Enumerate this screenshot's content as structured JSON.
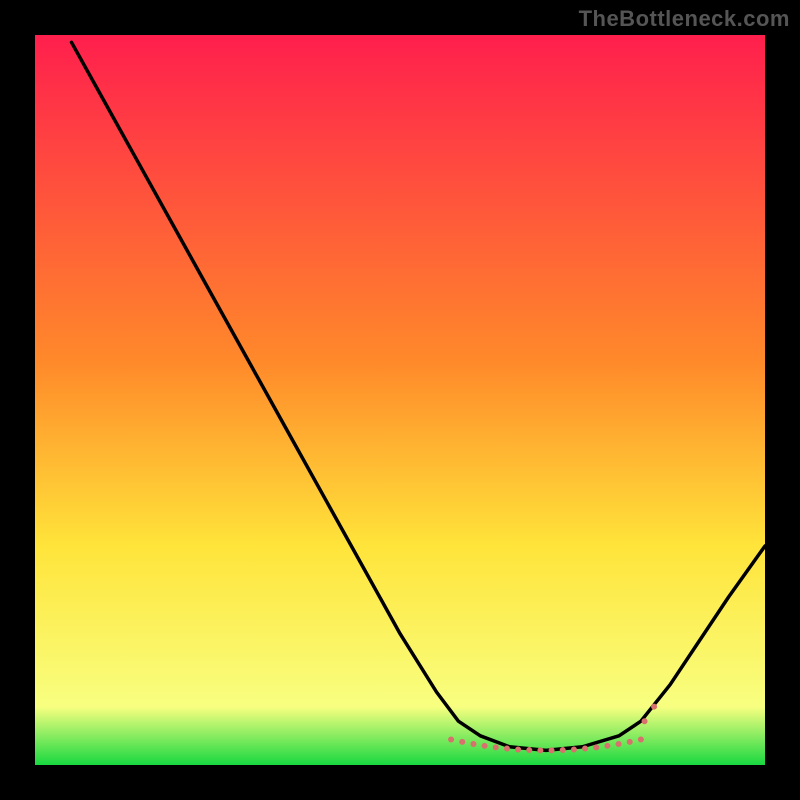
{
  "watermark": "TheBottleneck.com",
  "chart_data": {
    "type": "line",
    "title": "",
    "xlabel": "",
    "ylabel": "",
    "xlim": [
      0,
      100
    ],
    "ylim": [
      0,
      100
    ],
    "gradient_stops": [
      {
        "offset": 0,
        "color": "#ff1f4d"
      },
      {
        "offset": 45,
        "color": "#ff8a2a"
      },
      {
        "offset": 70,
        "color": "#ffe43a"
      },
      {
        "offset": 92,
        "color": "#f8ff80"
      },
      {
        "offset": 100,
        "color": "#18d840"
      }
    ],
    "curve_points": [
      {
        "x": 5,
        "y": 99
      },
      {
        "x": 10,
        "y": 90
      },
      {
        "x": 15,
        "y": 81
      },
      {
        "x": 20,
        "y": 72
      },
      {
        "x": 25,
        "y": 63
      },
      {
        "x": 30,
        "y": 54
      },
      {
        "x": 35,
        "y": 45
      },
      {
        "x": 40,
        "y": 36
      },
      {
        "x": 45,
        "y": 27
      },
      {
        "x": 50,
        "y": 18
      },
      {
        "x": 55,
        "y": 10
      },
      {
        "x": 58,
        "y": 6
      },
      {
        "x": 61,
        "y": 4
      },
      {
        "x": 65,
        "y": 2.5
      },
      {
        "x": 70,
        "y": 2
      },
      {
        "x": 75,
        "y": 2.5
      },
      {
        "x": 80,
        "y": 4
      },
      {
        "x": 83,
        "y": 6
      },
      {
        "x": 87,
        "y": 11
      },
      {
        "x": 91,
        "y": 17
      },
      {
        "x": 95,
        "y": 23
      },
      {
        "x": 100,
        "y": 30
      }
    ],
    "dotted_segment": {
      "x_start": 57,
      "x_end": 83,
      "y": 3.5,
      "color": "#d8706d",
      "dot_radius": 3,
      "dot_count": 18
    }
  }
}
